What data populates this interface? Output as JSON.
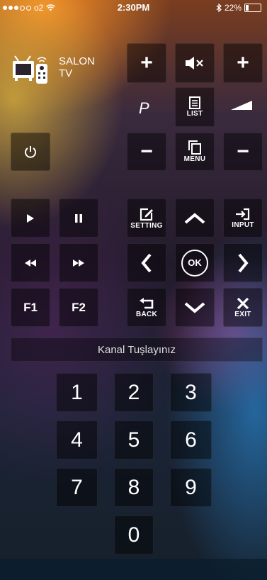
{
  "status_bar": {
    "carrier": "o2",
    "time": "2:30PM",
    "battery_percent": "22%",
    "battery_level": 0.22
  },
  "device": {
    "name_line1": "SALON",
    "name_line2": "TV",
    "icon": "tv-remote-icon"
  },
  "controls": {
    "vol_up": "+",
    "mute_icon": "mute-icon",
    "ch_up": "+",
    "program_label": "P",
    "list_label": "LIST",
    "volume_icon": "volume-icon",
    "power_icon": "power-icon",
    "vol_down": "−",
    "menu_label": "MENU",
    "ch_down": "−"
  },
  "playback": {
    "play_icon": "play-icon",
    "pause_icon": "pause-icon",
    "rewind_icon": "rewind-icon",
    "forward_icon": "fast-forward-icon",
    "f1": "F1",
    "f2": "F2"
  },
  "navigation": {
    "setting_label": "SETTING",
    "input_label": "INPUT",
    "ok_label": "OK",
    "back_label": "BACK",
    "exit_label": "EXIT"
  },
  "channel_prompt": "Kanal Tuşlayınız",
  "keypad": [
    "1",
    "2",
    "3",
    "4",
    "5",
    "6",
    "7",
    "8",
    "9",
    "0"
  ],
  "colors": {
    "button_bg": "#00000073",
    "text": "#ffffff"
  }
}
